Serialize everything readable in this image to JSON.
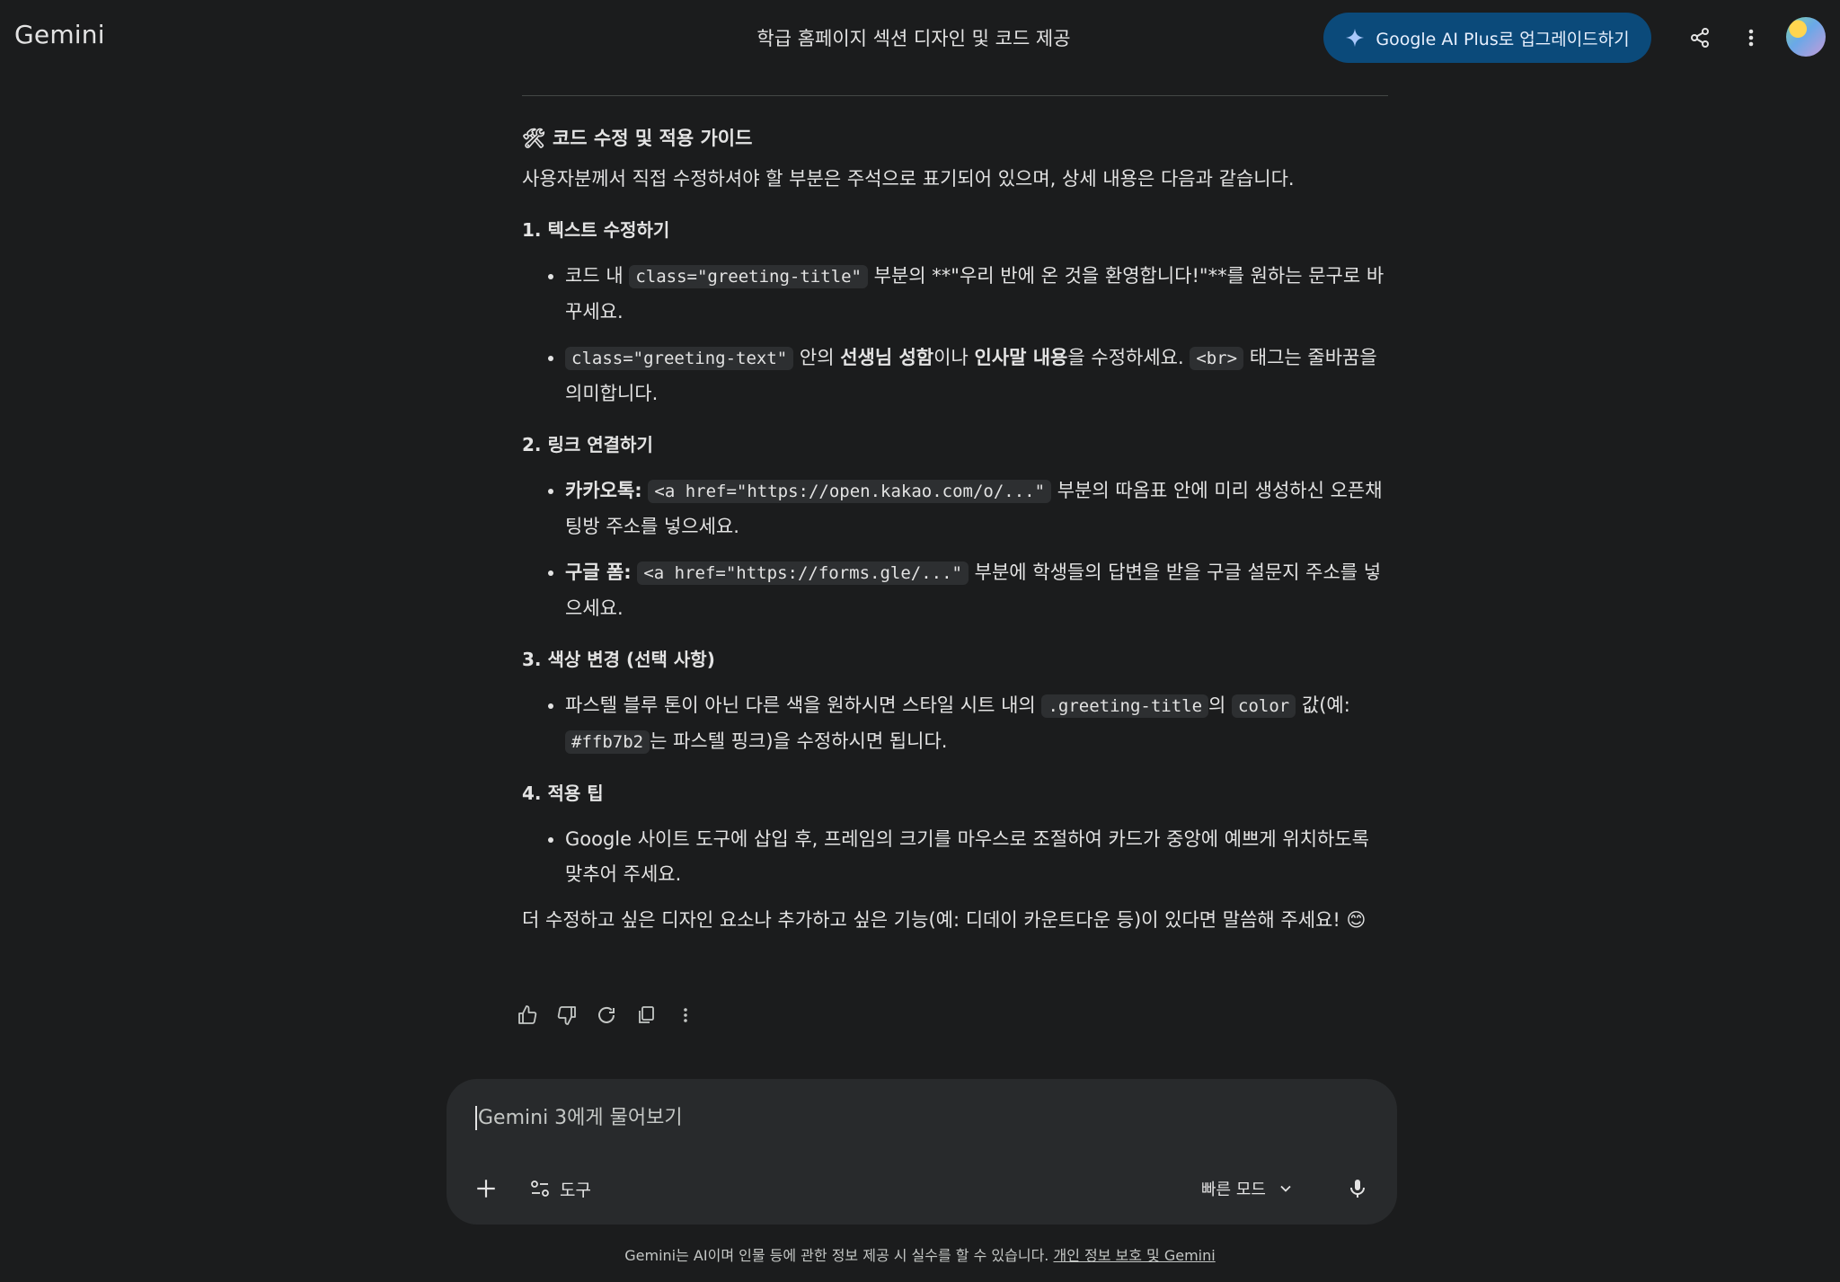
{
  "header": {
    "brand": "Gemini",
    "conversation_title": "학급 홈페이지 섹션 디자인 및 코드 제공",
    "upgrade_label": "Google AI Plus로 업그레이드하기"
  },
  "message": {
    "heading_icon": "🛠",
    "heading_text": " 코드 수정 및 적용 가이드",
    "intro": "사용자분께서 직접 수정하셔야 할 부분은 주석으로 표기되어 있으며, 상세 내용은 다음과 같습니다.",
    "s1": {
      "title": "1. 텍스트 수정하기",
      "b1": {
        "t1": "코드 내 ",
        "code1": "class=\"greeting-title\"",
        "t2": " 부분의 **\"우리 반에 온 것을 환영합니다!\"**를 원하는 문구로 바꾸세요."
      },
      "b2": {
        "code1": "class=\"greeting-text\"",
        "t1": " 안의 ",
        "bold1": "선생님 성함",
        "t2": "이나 ",
        "bold2": "인사말 내용",
        "t3": "을 수정하세요. ",
        "code2": "<br>",
        "t4": " 태그는 줄바꿈을 의미합니다."
      }
    },
    "s2": {
      "title": "2. 링크 연결하기",
      "b1": {
        "bold1": "카카오톡:",
        "t1": " ",
        "code1": "<a href=\"https://open.kakao.com/o/...\"",
        "t2": " 부분의 따옴표 안에 미리 생성하신 오픈채팅방 주소를 넣으세요."
      },
      "b2": {
        "bold1": "구글 폼:",
        "t1": " ",
        "code1": "<a href=\"https://forms.gle/...\"",
        "t2": " 부분에 학생들의 답변을 받을 구글 설문지 주소를 넣으세요."
      }
    },
    "s3": {
      "title": "3. 색상 변경 (선택 사항)",
      "b1": {
        "t1": "파스텔 블루 톤이 아닌 다른 색을 원하시면 스타일 시트 내의 ",
        "code1": ".greeting-title",
        "t2": "의 ",
        "code2": "color",
        "t3": " 값(예: ",
        "code3": "#ffb7b2",
        "t4": "는 파스텔 핑크)을 수정하시면 됩니다."
      }
    },
    "s4": {
      "title": "4. 적용 팁",
      "b1": {
        "t1": "Google 사이트 도구에 삽입 후, 프레임의 크기를 마우스로 조절하여 카드가 중앙에 예쁘게 위치하도록 맞추어 주세요."
      }
    },
    "closing": "더 수정하고 싶은 디자인 요소나 추가하고 싶은 기능(예: 디데이 카운트다운 등)이 있다면 말씀해 주세요! 😊"
  },
  "composer": {
    "placeholder": "Gemini 3에게 물어보기",
    "tools_label": "도구",
    "mode_label": "빠른 모드"
  },
  "footer": {
    "disclaimer": "Gemini는 AI이며 인물 등에 관한 정보 제공 시 실수를 할 수 있습니다. ",
    "privacy_link": "개인 정보 보호 및 Gemini"
  },
  "colors": {
    "background": "#1b1c1d",
    "upgrade_button": "#0b4a7a",
    "composer": "#282a2c",
    "code_bg": "#2d2f31"
  }
}
